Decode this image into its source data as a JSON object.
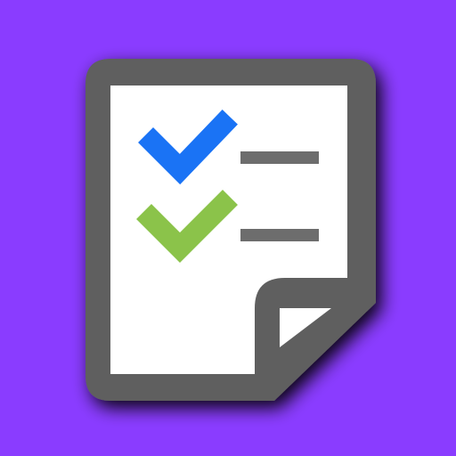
{
  "app_icon": {
    "name": "checklist-document-icon",
    "colors": {
      "background": "#8a3cff",
      "frame": "#5e5e5e",
      "page": "#ffffff",
      "check_primary": "#1a73f5",
      "check_secondary": "#8bc34a",
      "line": "#6d6d6d",
      "shadow": "#000000"
    },
    "items": [
      {
        "icon": "checkmark-icon",
        "state": "checked",
        "color_key": "check_primary"
      },
      {
        "icon": "checkmark-icon",
        "state": "checked",
        "color_key": "check_secondary"
      }
    ]
  }
}
